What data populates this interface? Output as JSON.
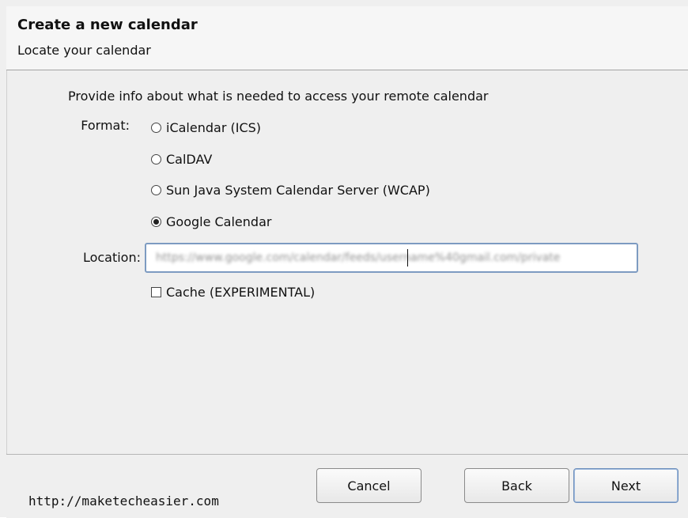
{
  "dialog": {
    "title": "Create a new calendar",
    "subtitle": "Locate your calendar",
    "intro_text": "Provide info about what is needed to access your remote calendar",
    "format_label": "Format:",
    "format_options": [
      {
        "label": "iCalendar (ICS)",
        "selected": false
      },
      {
        "label": "CalDAV",
        "selected": false
      },
      {
        "label": "Sun Java System Calendar Server (WCAP)",
        "selected": false
      },
      {
        "label": "Google Calendar",
        "selected": true
      }
    ],
    "location_label": "Location:",
    "location_value": "https://www.google.com/calendar/feeds/username%40gmail.com/private",
    "cache_label": "Cache (EXPERIMENTAL)",
    "buttons": {
      "cancel": "Cancel",
      "back": "Back",
      "next": "Next"
    },
    "footer_text": "http://maketecheasier.com"
  },
  "colors": {
    "dialog_background": "#efefef",
    "header_background": "#f6f6f6",
    "input_border": "#7d9bc1",
    "next_button_border": "#6e8fbc"
  }
}
